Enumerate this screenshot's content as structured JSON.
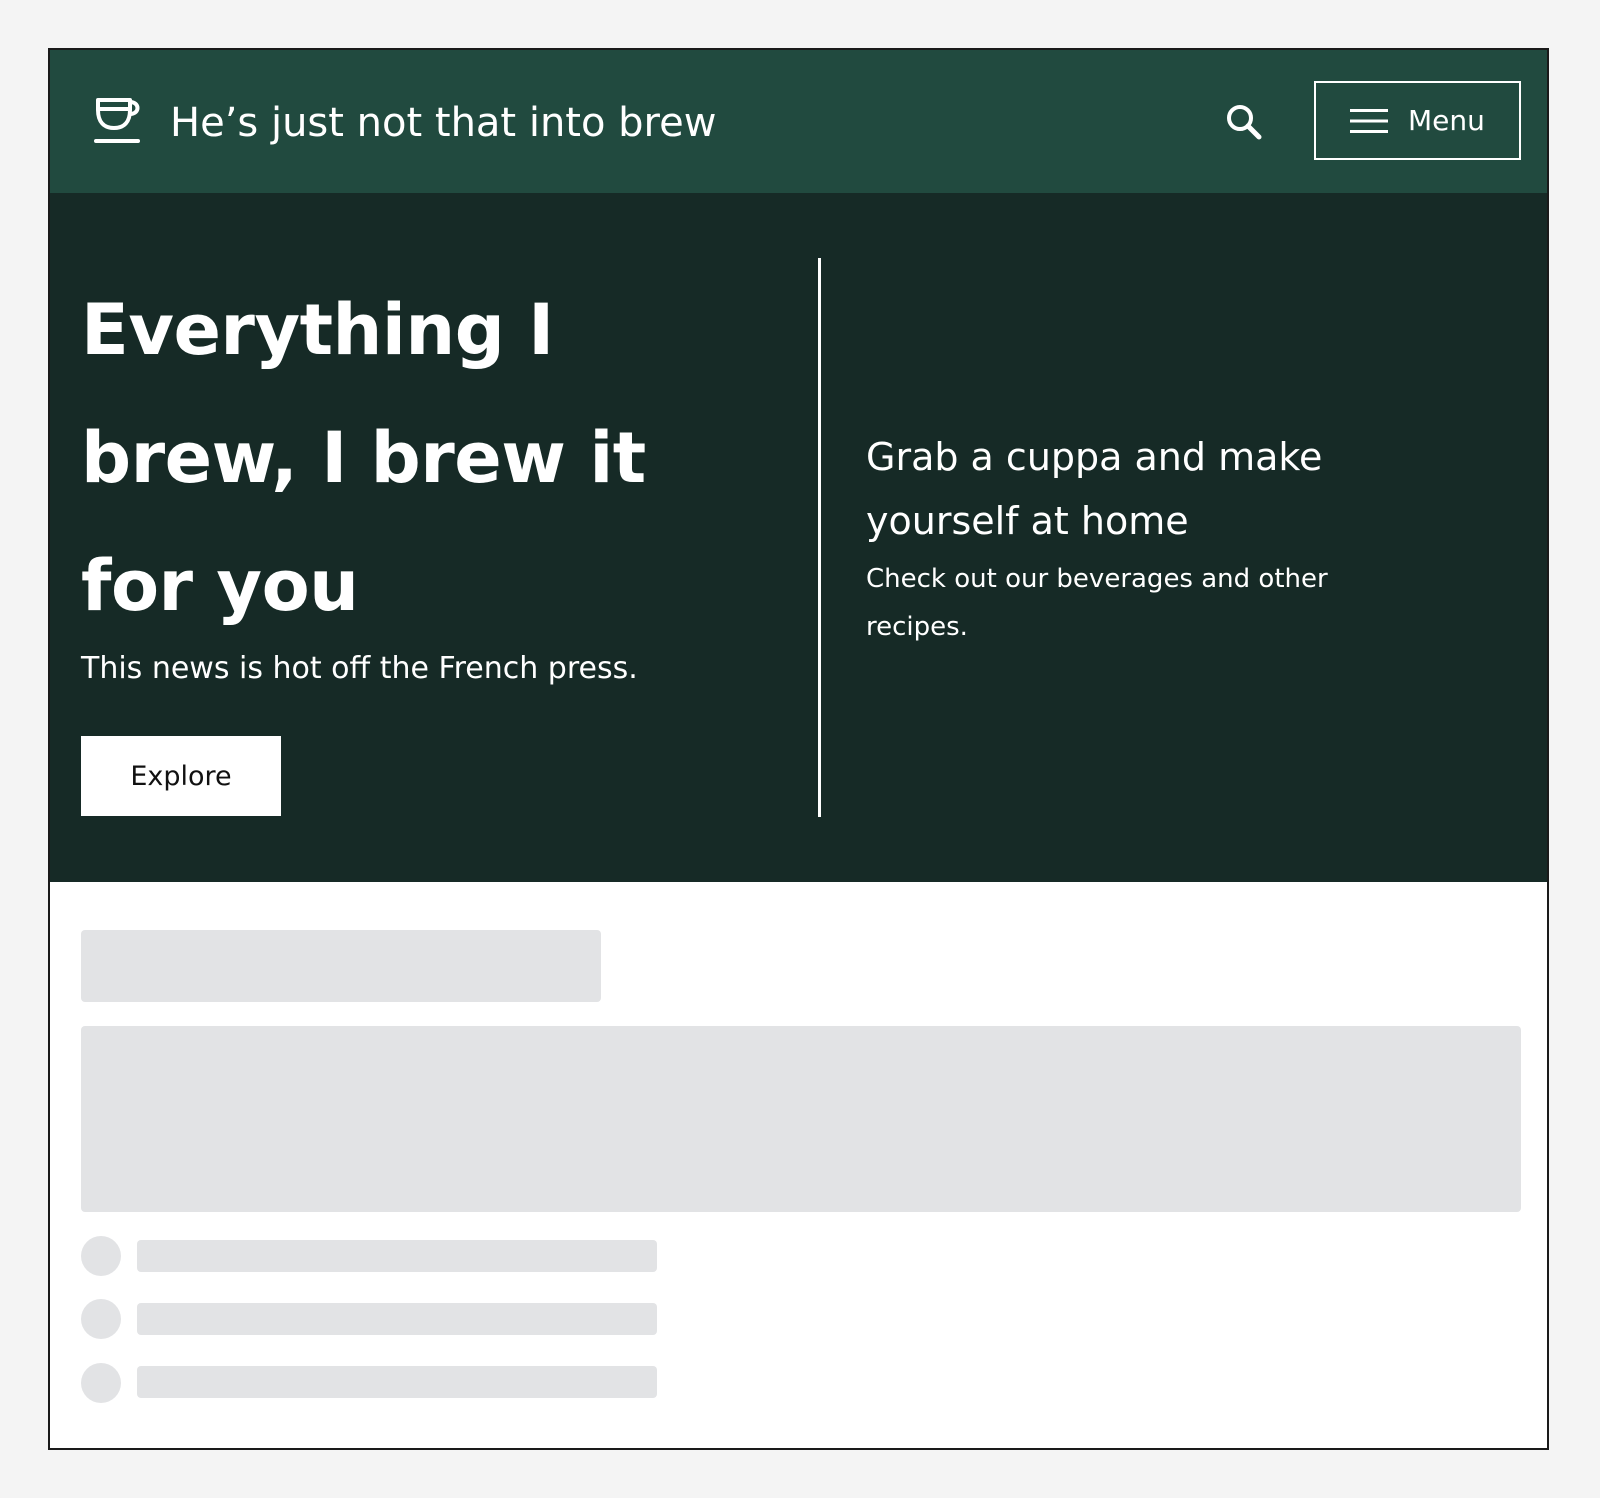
{
  "header": {
    "site_title": "He’s just not that into brew",
    "logo_icon": "coffee-cup-icon",
    "search_icon": "search-icon",
    "menu_label": "Menu",
    "menu_icon": "hamburger-icon",
    "background_color": "#214a3f"
  },
  "hero": {
    "headline": "Everything I brew, I brew it for you",
    "subtext": "This news is hot off the French press.",
    "cta_label": "Explore",
    "aside_title": "Grab a cuppa and make yourself at home",
    "aside_text": "Check out our beverages and other recipes.",
    "background_color": "#162a26"
  },
  "loading": {
    "skeleton_color": "#e2e3e5",
    "list_items": 3
  }
}
